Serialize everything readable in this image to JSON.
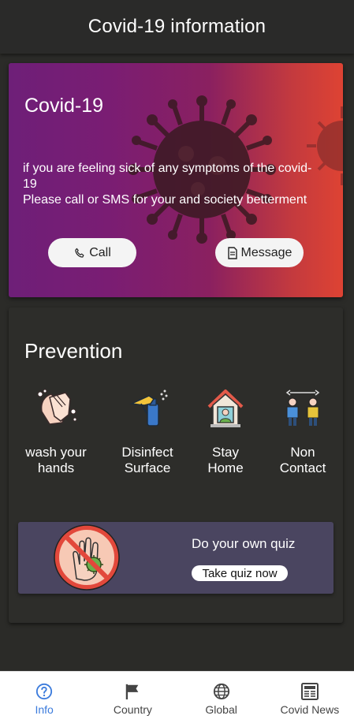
{
  "header": {
    "title": "Covid-19 information"
  },
  "banner": {
    "title": "Covid-19",
    "lines": [
      "if you are feeling sick of any symptoms of the covid-19",
      "Please call or SMS for your and society betterment"
    ],
    "call_label": "Call",
    "message_label": "Message"
  },
  "prevention": {
    "title": "Prevention",
    "items": [
      {
        "line1": "wash your",
        "line2": "hands",
        "icon": "washing-hands-icon"
      },
      {
        "line1": "Disinfect",
        "line2": "Surface",
        "icon": "spray-bottle-icon"
      },
      {
        "line1": "Stay",
        "line2": "Home",
        "icon": "stay-home-icon"
      },
      {
        "line1": "Non",
        "line2": "Contact",
        "icon": "distancing-icon"
      }
    ]
  },
  "quiz": {
    "title": "Do your own quiz",
    "button_label": "Take quiz now",
    "icon": "no-virus-hand-icon"
  },
  "nav": {
    "active": "info",
    "items": [
      {
        "id": "info",
        "label": "Info",
        "icon": "help-circle-icon"
      },
      {
        "id": "country",
        "label": "Country",
        "icon": "flag-icon"
      },
      {
        "id": "global",
        "label": "Global",
        "icon": "globe-icon"
      },
      {
        "id": "news",
        "label": "Covid News",
        "icon": "newspaper-icon"
      }
    ]
  },
  "colors": {
    "background": "#2b2b28",
    "banner_start": "#6e1f78",
    "banner_end": "#de4333",
    "quiz_card": "#4a4560",
    "nav_active": "#3b7bdc"
  }
}
